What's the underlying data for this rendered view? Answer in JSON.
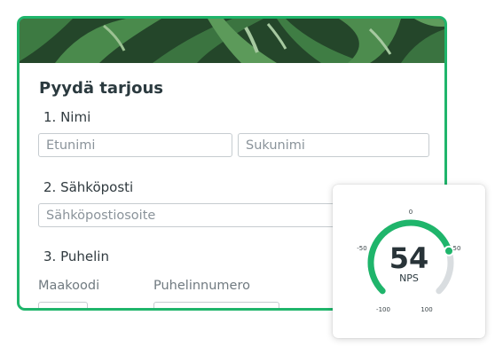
{
  "form": {
    "title": "Pyydä tarjous",
    "questions": [
      {
        "label": "1. Nimi",
        "fields": [
          {
            "placeholder": "Etunimi"
          },
          {
            "placeholder": "Sukunimi"
          }
        ]
      },
      {
        "label": "2. Sähköposti",
        "fields": [
          {
            "placeholder": "Sähköpostiosoite"
          }
        ]
      },
      {
        "label": "3. Puhelin",
        "sublabels": [
          "Maakoodi",
          "Puhelinnumero"
        ],
        "fields": [
          {
            "placeholder": ""
          },
          {
            "placeholder": ""
          }
        ]
      }
    ]
  },
  "nps": {
    "score": "54",
    "label": "NPS",
    "score_value": 54,
    "scale_min": -100,
    "scale_max": 100,
    "ticks": [
      "-100",
      "-50",
      "0",
      "50",
      "100"
    ]
  },
  "colors": {
    "accent": "#1fb56b",
    "banner_leaf": "#3d7a42",
    "banner_dark": "#24462a",
    "text_dark": "#2b3a3f",
    "gauge_track": "#d9dde0"
  },
  "icons": {
    "banner": "monstera-leaf-banner"
  }
}
